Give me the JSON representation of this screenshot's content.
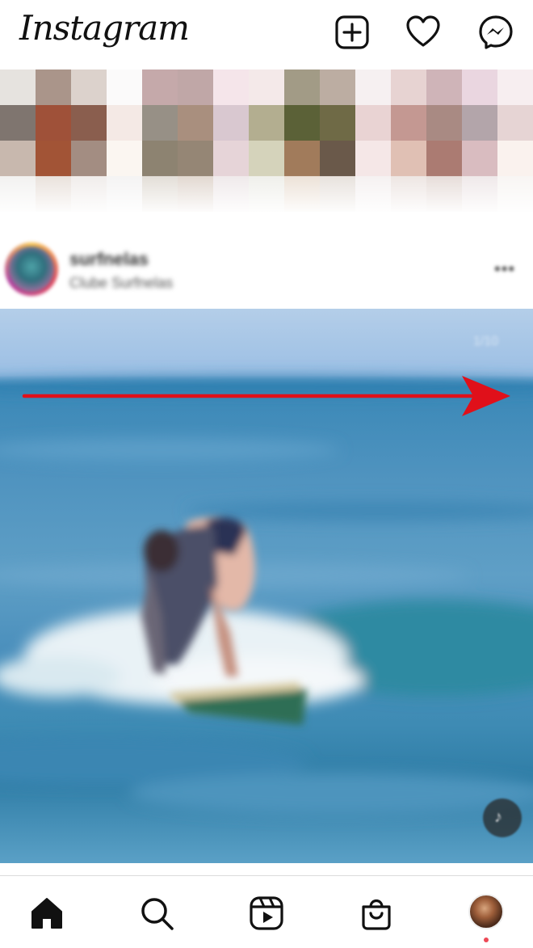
{
  "app": {
    "name": "Instagram"
  },
  "header": {
    "logo_text": "Instagram",
    "icons": [
      "add-post-icon",
      "heart-icon",
      "messenger-icon"
    ]
  },
  "post": {
    "username": "surfnelas",
    "subtitle": "Clube Surfnelas",
    "more_label": "•••",
    "media_counter": "1/10",
    "media_icon": "mute-icon"
  },
  "annotation": {
    "arrow_color": "#e0101a",
    "direction": "right"
  },
  "nav": {
    "items": [
      "home-icon",
      "search-icon",
      "reels-icon",
      "shop-icon",
      "profile-avatar"
    ],
    "notification_color": "#ed4956"
  },
  "colors": {
    "accent": "#ed4956",
    "text": "#111111",
    "divider": "#dbdbdb"
  }
}
